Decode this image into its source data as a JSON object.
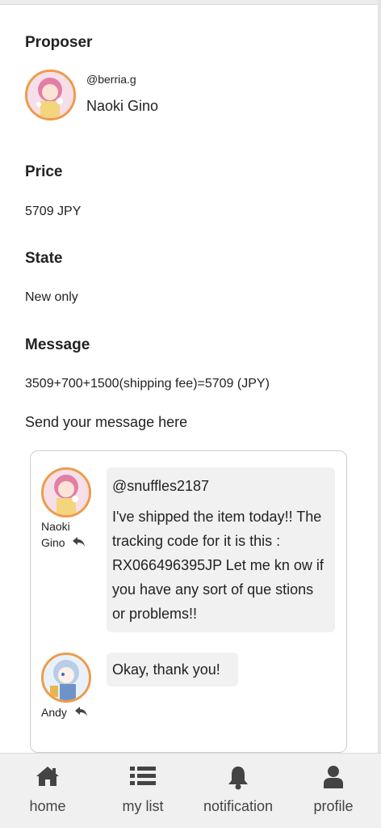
{
  "proposer": {
    "label": "Proposer",
    "handle": "@berria.g",
    "name": "Naoki Gino"
  },
  "price": {
    "label": "Price",
    "value": "5709 JPY"
  },
  "state": {
    "label": "State",
    "value": "New only"
  },
  "message": {
    "label": "Message",
    "value": "3509+700+1500(shipping fee)=5709 (JPY)"
  },
  "send_prompt": "Send your message here",
  "chat": {
    "messages": [
      {
        "author_line1": "Naoki",
        "author_line2": "Gino",
        "mention": "@snuffles2187",
        "text": "I've shipped the item today!! The tracking code for it is this : RX066496395JP Let me kn ow if you have any sort of que stions or problems!!"
      },
      {
        "author_line1": "Andy",
        "text": "Okay, thank you!"
      }
    ]
  },
  "nav": {
    "items": [
      {
        "label": "home",
        "icon": "home-icon"
      },
      {
        "label": "my list",
        "icon": "list-icon"
      },
      {
        "label": "notification",
        "icon": "bell-icon"
      },
      {
        "label": "profile",
        "icon": "user-icon"
      }
    ]
  },
  "colors": {
    "avatar_border": "#ee9a49",
    "bubble_bg": "#f1f1f1",
    "nav_bg": "#f0f0f0"
  }
}
